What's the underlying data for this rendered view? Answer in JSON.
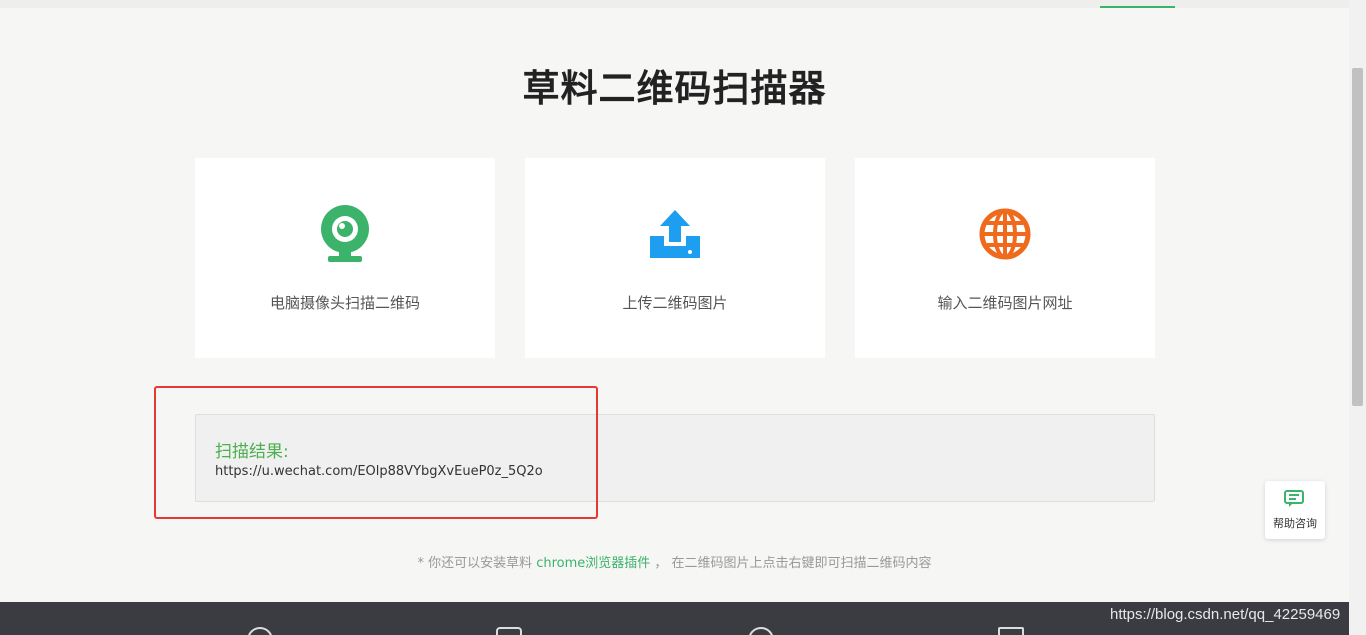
{
  "page": {
    "title": "草料二维码扫描器"
  },
  "cards": [
    {
      "label": "电脑摄像头扫描二维码",
      "icon": "webcam-icon",
      "color": "#3bb36a"
    },
    {
      "label": "上传二维码图片",
      "icon": "upload-icon",
      "color": "#1e9ef0"
    },
    {
      "label": "输入二维码图片网址",
      "icon": "globe-icon",
      "color": "#f06a1e"
    }
  ],
  "result": {
    "title": "扫描结果:",
    "url": "https://u.wechat.com/EOlp88VYbgXvEueP0z_5Q2o"
  },
  "tip": {
    "prefix": "* 你还可以安装草料 ",
    "link": "chrome浏览器插件",
    "suffix": " ，  在二维码图片上点击右键即可扫描二维码内容"
  },
  "help": {
    "label": "帮助咨询"
  },
  "watermark": "https://blog.csdn.net/qq_42259469"
}
